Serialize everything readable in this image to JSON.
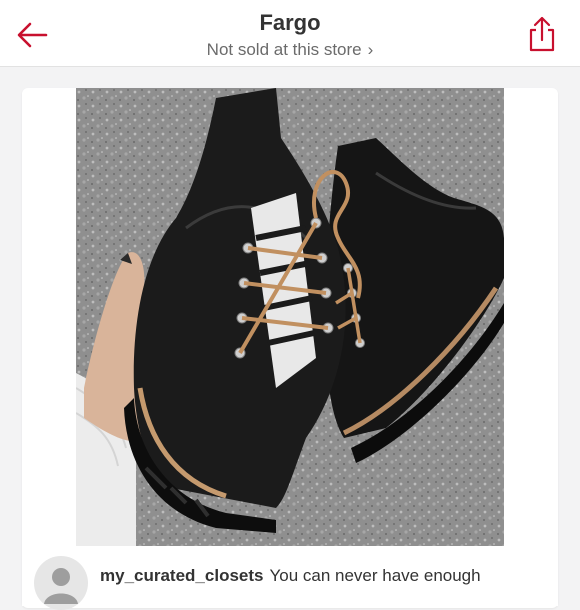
{
  "header": {
    "title": "Fargo",
    "subtitle": "Not sold at this store",
    "accent_color": "#c8102e",
    "back_icon": "arrow-left-icon",
    "share_icon": "share-icon"
  },
  "post": {
    "image_icon": "product-photo",
    "username": "my_curated_closets",
    "comment": "You can never have enough"
  }
}
